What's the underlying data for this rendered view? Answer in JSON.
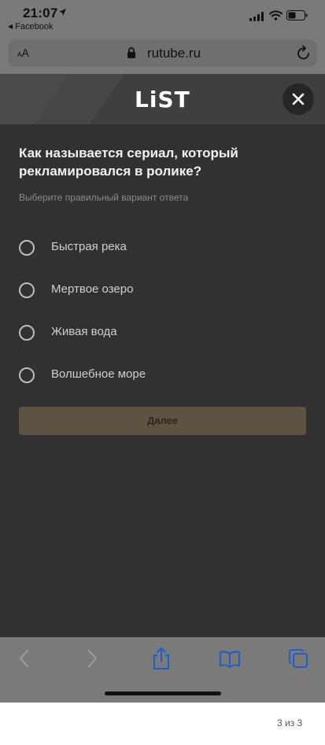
{
  "status_bar": {
    "time": "21:07",
    "back_app": "Facebook"
  },
  "browser": {
    "text_size_button": "AA",
    "url": "rutube.ru"
  },
  "modal": {
    "brand": "LiST",
    "question": "Как называется сериал, который рекламировался в ролике?",
    "hint": "Выберите правильный вариант ответа",
    "options": [
      {
        "label": "Быстрая река",
        "selected": false
      },
      {
        "label": "Мертвое озеро",
        "selected": false
      },
      {
        "label": "Живая вода",
        "selected": false
      },
      {
        "label": "Волшебное море",
        "selected": false
      }
    ],
    "next_button": "Далее",
    "accent_color": "#5e5242"
  },
  "toolbar": {
    "icons": [
      "back-icon",
      "forward-icon",
      "share-icon",
      "bookmarks-icon",
      "tabs-icon"
    ]
  },
  "page_counter": "3 из 3"
}
